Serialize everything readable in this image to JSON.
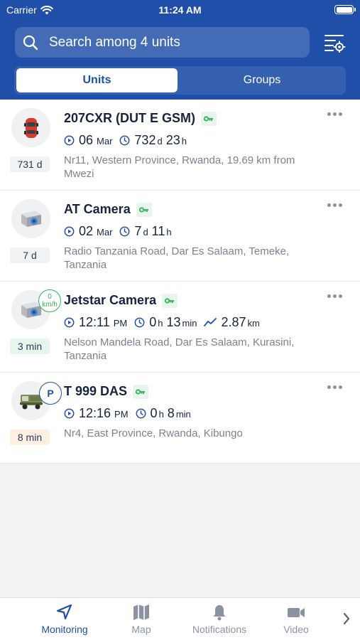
{
  "status_bar": {
    "carrier": "Carrier",
    "time": "11:24 AM"
  },
  "search": {
    "placeholder": "Search among 4 units"
  },
  "tabs": {
    "units": "Units",
    "groups": "Groups",
    "active": "Units"
  },
  "units": [
    {
      "name": "207CXR (DUT E GSM)",
      "badge": "731 d",
      "badge_style": "gray",
      "icon": "red-car-icon",
      "info": [
        {
          "icon": "play-circle-icon",
          "big": "06",
          "small": "Mar"
        },
        {
          "icon": "clock-icon",
          "big": "732",
          "small": "d",
          "big2": "23",
          "small2": "h"
        }
      ],
      "address": "Nr11, Western Province, Rwanda, 19.69 km from Mwezi"
    },
    {
      "name": "AT Camera",
      "badge": "7 d",
      "badge_style": "gray",
      "icon": "camera-icon",
      "info": [
        {
          "icon": "play-circle-icon",
          "big": "02",
          "small": "Mar"
        },
        {
          "icon": "clock-icon",
          "big": "7",
          "small": "d",
          "big2": "11",
          "small2": "h"
        }
      ],
      "address": "Radio Tanzania Road, Dar Es Salaam, Temeke, Tanzania"
    },
    {
      "name": "Jetstar Camera",
      "badge": "3 min",
      "badge_style": "green",
      "icon": "camera-icon",
      "speed_value": "0",
      "speed_unit": "km/h",
      "info": [
        {
          "icon": "play-circle-icon",
          "big": "12:11",
          "small": "PM"
        },
        {
          "icon": "clock-icon",
          "big": "0",
          "small": "h",
          "big2": "13",
          "small2": "min"
        },
        {
          "icon": "trend-icon",
          "big": "2.87",
          "small": "km"
        }
      ],
      "address": "Nelson Mandela Road, Dar Es Salaam, Kurasini, Tanzania"
    },
    {
      "name": "T 999 DAS",
      "badge": "8 min",
      "badge_style": "orange",
      "icon": "truck-icon",
      "parking_label": "P",
      "info": [
        {
          "icon": "play-circle-icon",
          "big": "12:16",
          "small": "PM"
        },
        {
          "icon": "clock-icon",
          "big": "0",
          "small": "h",
          "big2": "8",
          "small2": "min"
        }
      ],
      "address": "Nr4, East Province, Rwanda, Kibungo"
    }
  ],
  "tabbar": [
    {
      "label": "Monitoring",
      "icon": "navigation-arrow-icon",
      "active": true
    },
    {
      "label": "Map",
      "icon": "map-icon",
      "active": false
    },
    {
      "label": "Notifications",
      "icon": "bell-icon",
      "active": false
    },
    {
      "label": "Video",
      "icon": "video-camera-icon",
      "active": false
    }
  ],
  "colors": {
    "primary": "#1f4fa8",
    "accent_green": "#36b05a",
    "muted": "#8a93a3"
  }
}
